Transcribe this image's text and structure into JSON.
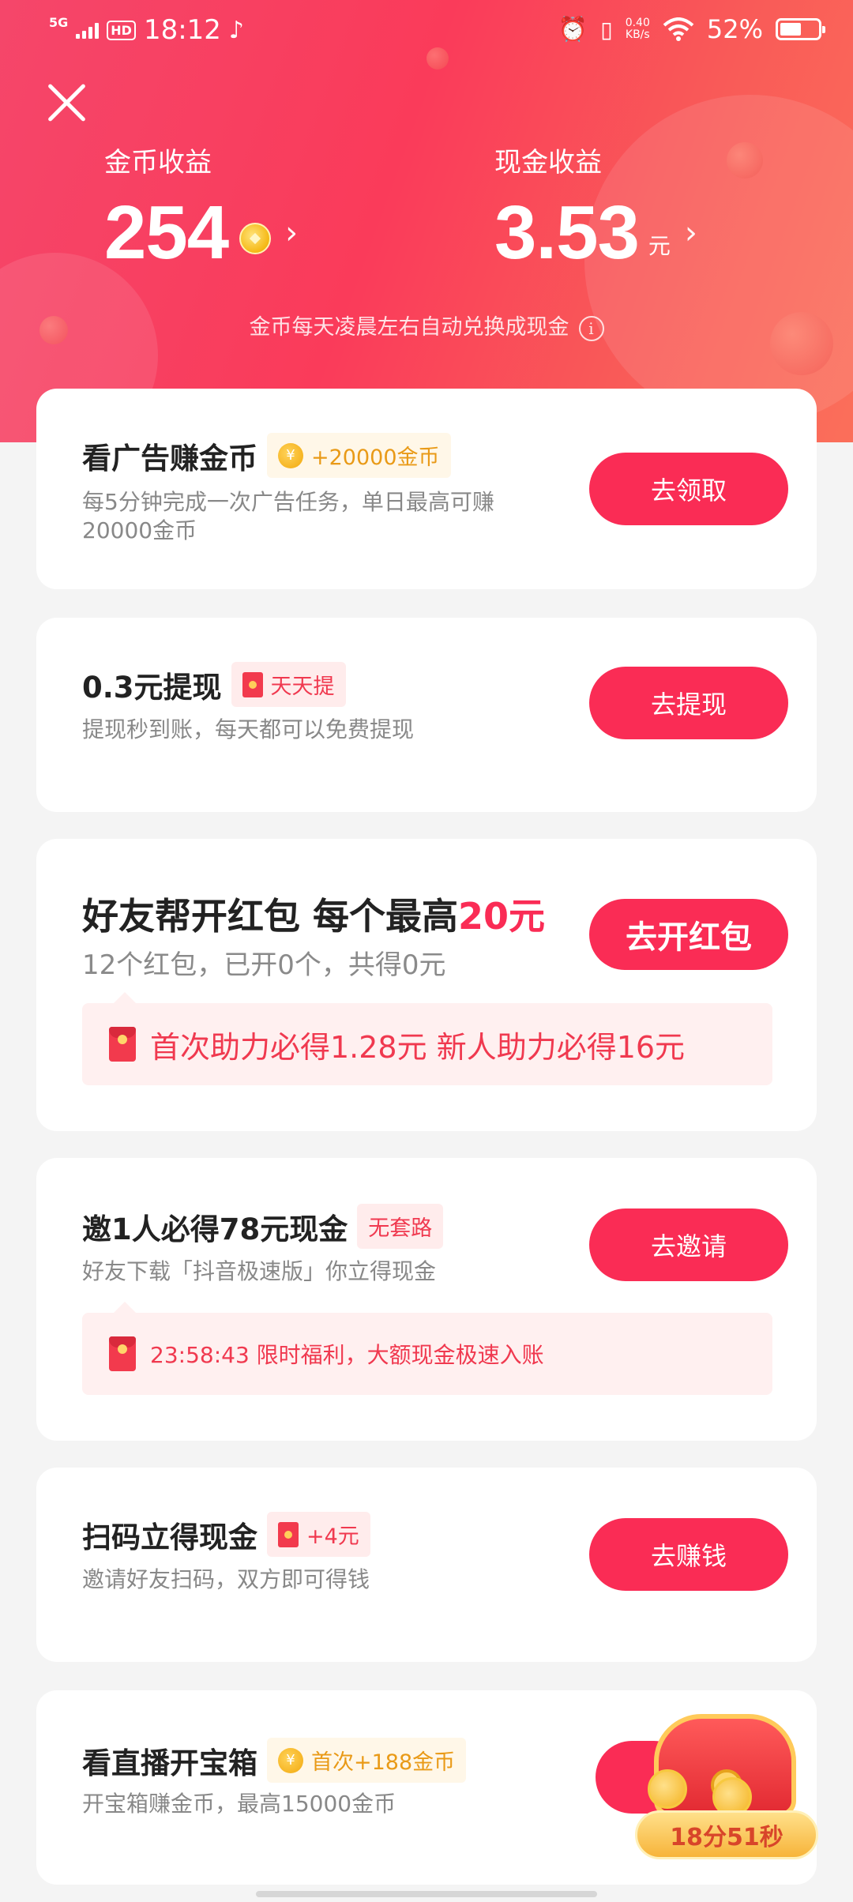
{
  "status_bar": {
    "network": "5G",
    "hd": "HD",
    "time": "18:12",
    "app_icon": "tiktok-icon",
    "speed_value": "0.40",
    "speed_unit": "KB/s",
    "battery": "52%"
  },
  "earnings": {
    "coin_label": "金币收益",
    "coin_value": "254",
    "cash_label": "现金收益",
    "cash_value": "3.53",
    "cash_unit": "元",
    "note": "金币每天凌晨左右自动兑换成现金"
  },
  "tasks": [
    {
      "title": "看广告赚金币",
      "tag": "+20000金币",
      "desc_line1": "每5分钟完成一次广告任务，单日最高可赚",
      "desc_line2": "20000金币",
      "button": "去领取"
    },
    {
      "title": "0.3元提现",
      "tag": "天天提",
      "desc": "提现秒到账，每天都可以免费提现",
      "button": "去提现"
    },
    {
      "title_main": "好友帮开红包 每个最高",
      "title_highlight": "20元",
      "desc": "12个红包，已开0个，共得0元",
      "button": "去开红包",
      "banner": "首次助力必得1.28元 新人助力必得16元"
    },
    {
      "title": "邀1人必得78元现金",
      "tag": "无套路",
      "desc": "好友下载「抖音极速版」你立得现金",
      "button": "去邀请",
      "banner": "23:58:43 限时福利，大额现金极速入账"
    },
    {
      "title": "扫码立得现金",
      "tag": "+4元",
      "desc": "邀请好友扫码，双方即可得钱",
      "button": "去赚钱"
    },
    {
      "title": "看直播开宝箱",
      "tag": "首次+188金币",
      "desc": "开宝箱赚金币，最高15000金币",
      "timer": "18分51秒"
    }
  ],
  "colors": {
    "accent": "#fa2c55",
    "hero_gradient_start": "#f5466a",
    "hero_gradient_end": "#fb6f5a",
    "gold_text": "#e99a17"
  }
}
